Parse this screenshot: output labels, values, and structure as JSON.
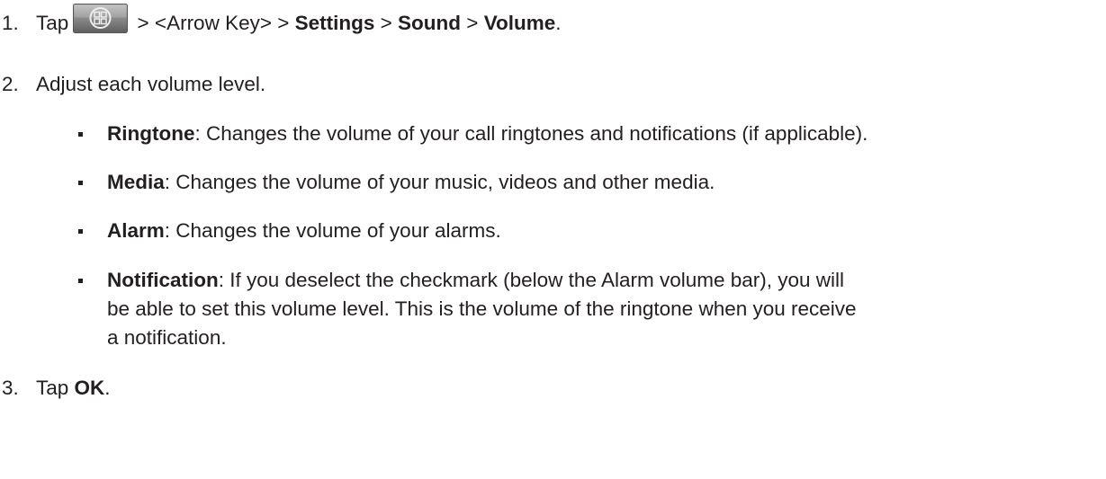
{
  "steps": [
    {
      "number": "1.",
      "parts": {
        "tap": "Tap",
        "icon": "windows-start-button-icon",
        "arrow_key": " > <Arrow Key> > ",
        "settings": "Settings",
        "sep1": " > ",
        "sound": "Sound",
        "sep2": " > ",
        "volume": "Volume",
        "end": "."
      }
    },
    {
      "number": "2.",
      "text": "Adjust each volume level.",
      "items": [
        {
          "term": "Ringtone",
          "desc": ": Changes the volume of your call ringtones and notifications (if applicable)."
        },
        {
          "term": "Media",
          "desc": ": Changes the volume of your music, videos and other media."
        },
        {
          "term": "Alarm",
          "desc": ": Changes the volume of your alarms."
        },
        {
          "term": "Notification",
          "desc_lines": [
            ": If you deselect the checkmark (below the Alarm volume bar), you will",
            "be able to set this volume level. This is the volume of the ringtone when you receive",
            "a notification."
          ]
        }
      ]
    },
    {
      "number": "3.",
      "parts": {
        "tap": "Tap ",
        "ok": "OK",
        "end": "."
      }
    }
  ]
}
